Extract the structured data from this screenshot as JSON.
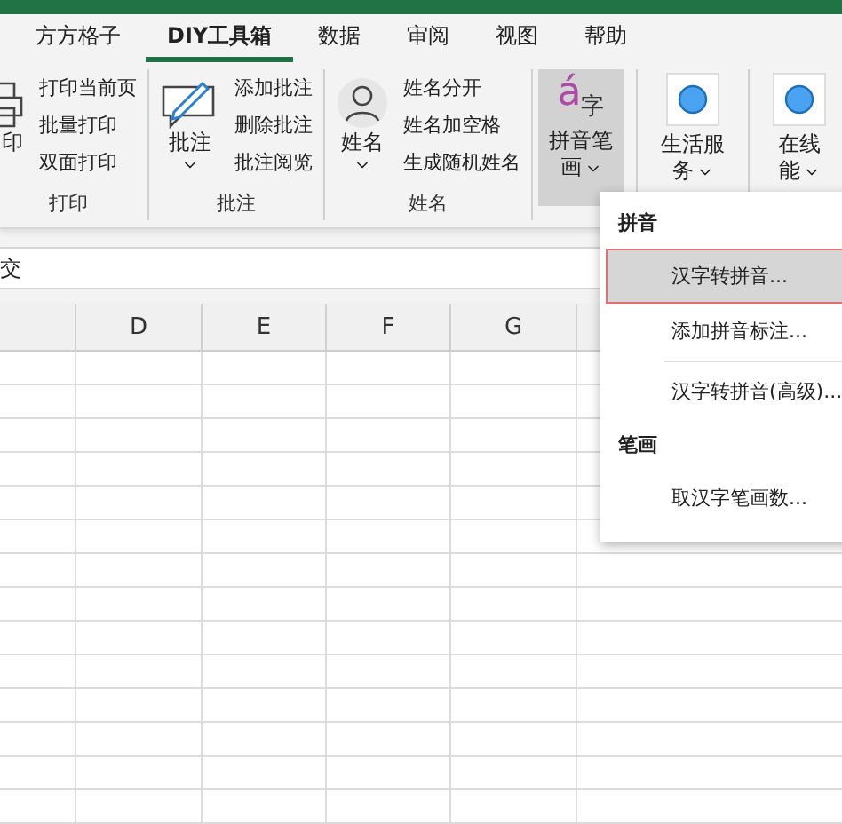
{
  "tabs": [
    {
      "label": "方方格子",
      "selected": false
    },
    {
      "label": "DIY工具箱",
      "selected": true
    },
    {
      "label": "数据",
      "selected": false
    },
    {
      "label": "审阅",
      "selected": false
    },
    {
      "label": "视图",
      "selected": false
    },
    {
      "label": "帮助",
      "selected": false
    }
  ],
  "ribbon": {
    "groups": [
      {
        "label": "打印",
        "big": {
          "kind": "printer",
          "lines": [
            "印"
          ],
          "caret": false
        },
        "items": [
          "打印当前页",
          "批量打印",
          "双面打印"
        ]
      },
      {
        "label": "批注",
        "big": {
          "kind": "comment",
          "lines": [
            "批注"
          ],
          "caret": true
        },
        "items": [
          "添加批注",
          "删除批注",
          "批注阅览"
        ]
      },
      {
        "label": "姓名",
        "big": {
          "kind": "person",
          "lines": [
            "姓名"
          ],
          "caret": true
        },
        "items": [
          "姓名分开",
          "姓名加空格",
          "生成随机姓名"
        ]
      }
    ],
    "buttons": [
      {
        "kind": "pinyin",
        "glyph": "á",
        "glyph_small": "字",
        "lines": [
          "拼音笔",
          "画"
        ],
        "caret": true,
        "pressed": true
      },
      {
        "kind": "circle",
        "lines": [
          "生活服",
          "务"
        ],
        "caret": true,
        "pressed": false
      },
      {
        "kind": "circle",
        "lines": [
          "在线",
          "能"
        ],
        "caret": true,
        "pressed": false
      }
    ]
  },
  "formula_bar": {
    "value": "交"
  },
  "columns": [
    "D",
    "E",
    "F",
    "G"
  ],
  "menu": {
    "items": [
      {
        "kind": "header",
        "label": "拼音"
      },
      {
        "kind": "item",
        "label": "汉字转拼音...",
        "selected": true
      },
      {
        "kind": "item",
        "label": "添加拼音标注...",
        "selected": false
      },
      {
        "kind": "separator"
      },
      {
        "kind": "item",
        "label": "汉字转拼音(高级)...",
        "selected": false
      },
      {
        "kind": "header",
        "label": "笔画"
      },
      {
        "kind": "item",
        "label": "取汉字笔画数...",
        "selected": false
      }
    ]
  }
}
